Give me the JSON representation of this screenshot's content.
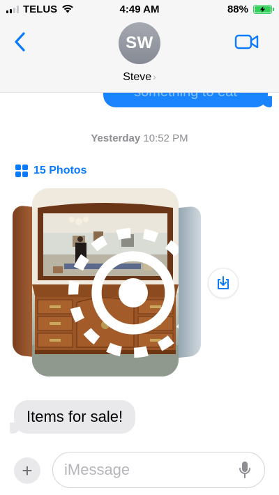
{
  "status_bar": {
    "carrier": "TELUS",
    "time": "4:49 AM",
    "battery_percent": "88%",
    "battery_color": "#30d158"
  },
  "header": {
    "avatar_initials": "SW",
    "contact_name": "Steve",
    "back_icon": "chevron-left-icon",
    "video_icon": "video-camera-icon"
  },
  "messages": {
    "sent_partial_text": "something to eat",
    "timestamp_day": "Yesterday",
    "timestamp_time": "10:52 PM",
    "photos_label": "15 Photos",
    "received_text": "Items for sale!"
  },
  "input": {
    "placeholder": "iMessage",
    "add_label": "+"
  },
  "colors": {
    "accent": "#0a7aff",
    "sent_bubble": "#1a84ff",
    "received_bubble": "#e9e9eb"
  }
}
